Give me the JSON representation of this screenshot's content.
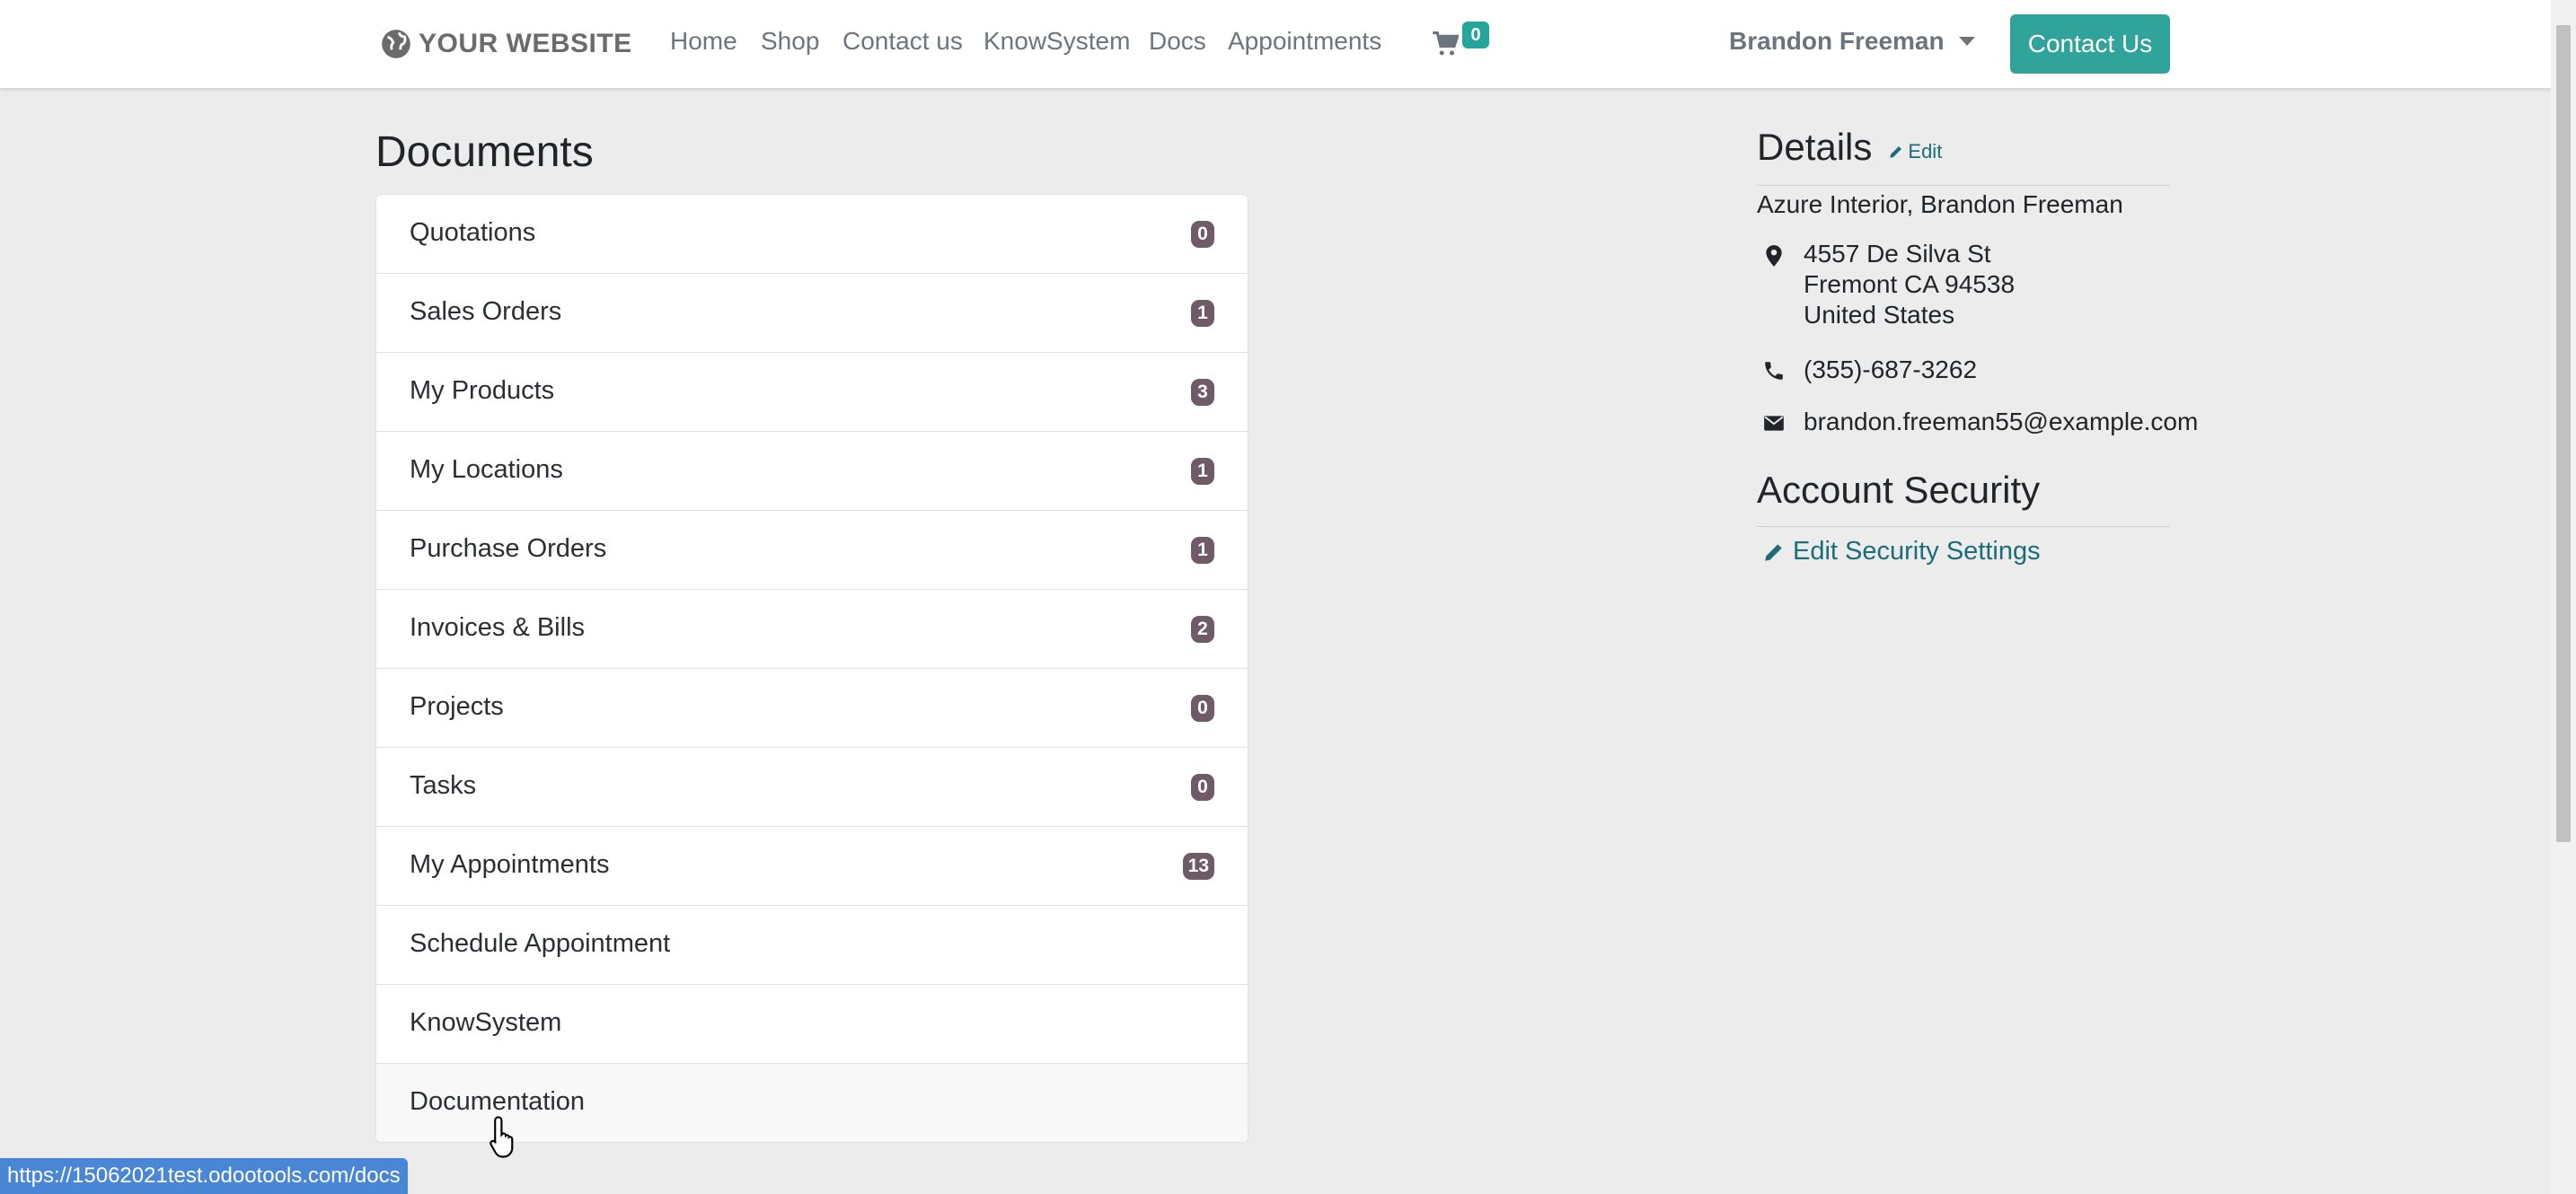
{
  "header": {
    "logo_text": "YOUR WEBSITE",
    "nav": [
      "Home",
      "Shop",
      "Contact us",
      "KnowSystem",
      "Docs",
      "Appointments"
    ],
    "cart_count": "0",
    "user_name": "Brandon Freeman",
    "contact_button": "Contact Us"
  },
  "documents": {
    "title": "Documents",
    "items": [
      {
        "label": "Quotations",
        "count": "0"
      },
      {
        "label": "Sales Orders",
        "count": "1"
      },
      {
        "label": "My Products",
        "count": "3"
      },
      {
        "label": "My Locations",
        "count": "1"
      },
      {
        "label": "Purchase Orders",
        "count": "1"
      },
      {
        "label": "Invoices & Bills",
        "count": "2"
      },
      {
        "label": "Projects",
        "count": "0"
      },
      {
        "label": "Tasks",
        "count": "0"
      },
      {
        "label": "My Appointments",
        "count": "13"
      },
      {
        "label": "Schedule Appointment"
      },
      {
        "label": "KnowSystem"
      },
      {
        "label": "Documentation"
      }
    ]
  },
  "details": {
    "title": "Details",
    "edit_label": "Edit",
    "company_name": "Azure Interior, Brandon Freeman",
    "address": [
      "4557 De Silva St",
      "Fremont CA 94538",
      "United States"
    ],
    "phone": "(355)-687-3262",
    "email": "brandon.freeman55@example.com"
  },
  "security": {
    "title": "Account Security",
    "edit_link": "Edit Security Settings"
  },
  "status_bar": {
    "url": "https://15062021test.odootools.com/docs"
  },
  "colors": {
    "accent": "#30a39a",
    "badge": "#6f5a67",
    "link": "#1b6d77",
    "background": "#ececec"
  }
}
